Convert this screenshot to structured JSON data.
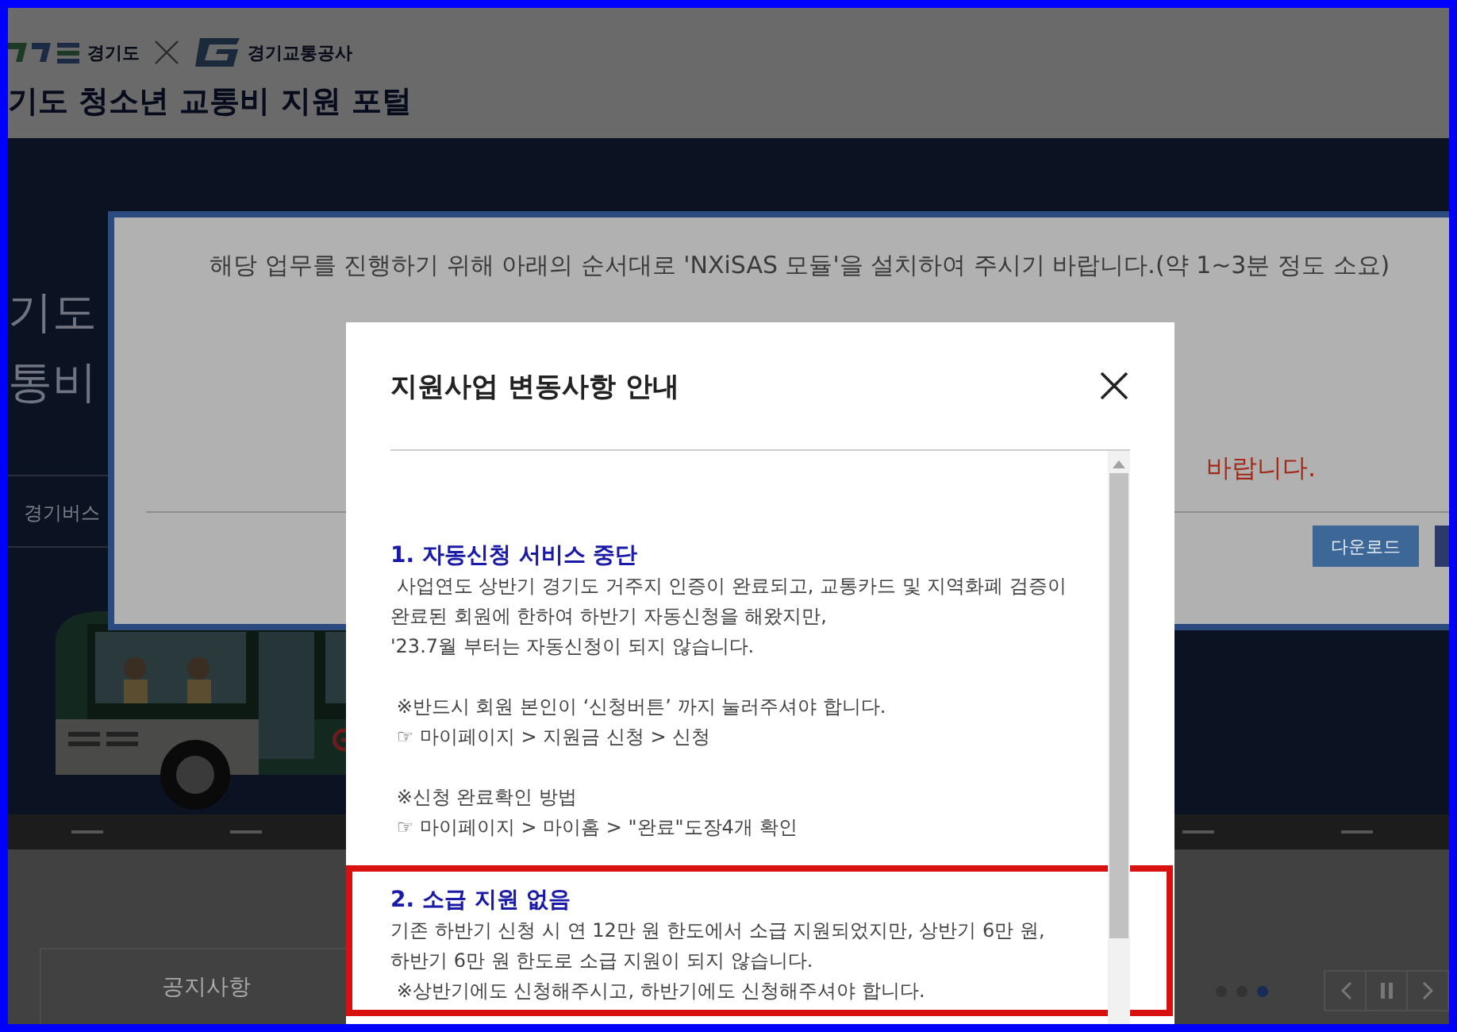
{
  "header": {
    "logo_text": "경기도",
    "partner_logo_text": "경기교통공사",
    "title": "기도 청소년 교통비 지원 포털"
  },
  "hero": {
    "title_lines": [
      "기도",
      "통비"
    ],
    "menu_item": "경기버스"
  },
  "notice": {
    "title": "공지사항"
  },
  "carousel": {
    "dots": [
      {
        "selected": false
      },
      {
        "selected": false
      },
      {
        "selected": true
      }
    ]
  },
  "install_dialog": {
    "message": "해당 업무를 진행하기 위해 아래의 순서대로 'NXiSAS 모듈'을 설치하여 주시기 바랍니다.(약 1~3분 정도 소요)",
    "warning_text": "바랍니다.",
    "buttons": [
      "다운로드"
    ]
  },
  "notice_dialog": {
    "title": "지원사업 변동사항 안내",
    "sections": [
      {
        "heading": "1. 자동신청 서비스 중단",
        "highlighted": false,
        "paragraphs": [
          [
            " 사업연도 상반기 경기도 거주지 인증이 완료되고, 교통카드 및 지역화폐 검증이",
            "완료된 회원에 한하여 하반기 자동신청을 해왔지만,",
            "'23.7월 부터는 자동신청이 되지 않습니다."
          ],
          [
            " ※반드시 회원 본인이 ‘신청버튼’ 까지 눌러주셔야 합니다.",
            " ☞ 마이페이지 > 지원금 신청 > 신청"
          ],
          [
            " ※신청 완료확인 방법",
            " ☞ 마이페이지 > 마이홈 > \"완료\"도장4개 확인"
          ]
        ]
      },
      {
        "heading": "2. 소급 지원 없음",
        "highlighted": true,
        "paragraphs": [
          [
            "기존 하반기 신청 시 연 12만 원 한도에서 소급 지원되었지만, 상반기 6만 원,",
            "하반기 6만 원 한도로 소급 지원이 되지 않습니다.",
            " ※상반기에도 신청해주시고, 하반기에도 신청해주셔야 합니다."
          ]
        ]
      }
    ]
  }
}
